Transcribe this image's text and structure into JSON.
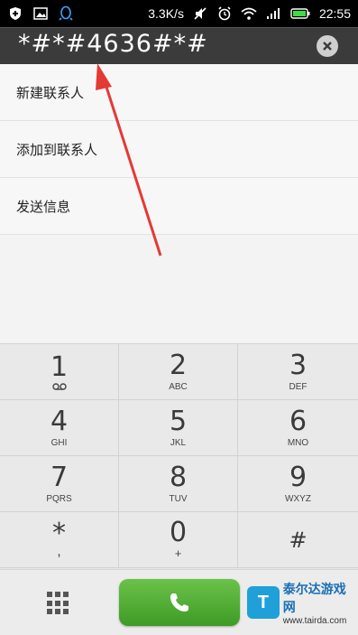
{
  "status_bar": {
    "speed": "3.3K/s",
    "time": "22:55",
    "icons": [
      "shield-icon",
      "image-icon",
      "qq-icon",
      "mute-icon",
      "alarm-icon",
      "wifi-icon",
      "signal-icon",
      "battery-icon"
    ]
  },
  "dialer": {
    "number": "*#*#4636#*#",
    "menu": [
      {
        "label": "新建联系人"
      },
      {
        "label": "添加到联系人"
      },
      {
        "label": "发送信息"
      }
    ],
    "keys": [
      {
        "digit": "1",
        "letters": "",
        "sub_icon": "voicemail-icon"
      },
      {
        "digit": "2",
        "letters": "ABC"
      },
      {
        "digit": "3",
        "letters": "DEF"
      },
      {
        "digit": "4",
        "letters": "GHI"
      },
      {
        "digit": "5",
        "letters": "JKL"
      },
      {
        "digit": "6",
        "letters": "MNO"
      },
      {
        "digit": "7",
        "letters": "PQRS"
      },
      {
        "digit": "8",
        "letters": "TUV"
      },
      {
        "digit": "9",
        "letters": "WXYZ"
      },
      {
        "digit": "*",
        "letters": ","
      },
      {
        "digit": "0",
        "letters": "+"
      },
      {
        "digit": "#",
        "letters": ""
      }
    ]
  },
  "watermark": {
    "title": "泰尔达游戏网",
    "url": "www.tairda.com",
    "logo_letter": "T"
  },
  "colors": {
    "call_green": "#4caf30",
    "number_bar": "#3b3b3b",
    "annotation_arrow": "#e53935"
  }
}
